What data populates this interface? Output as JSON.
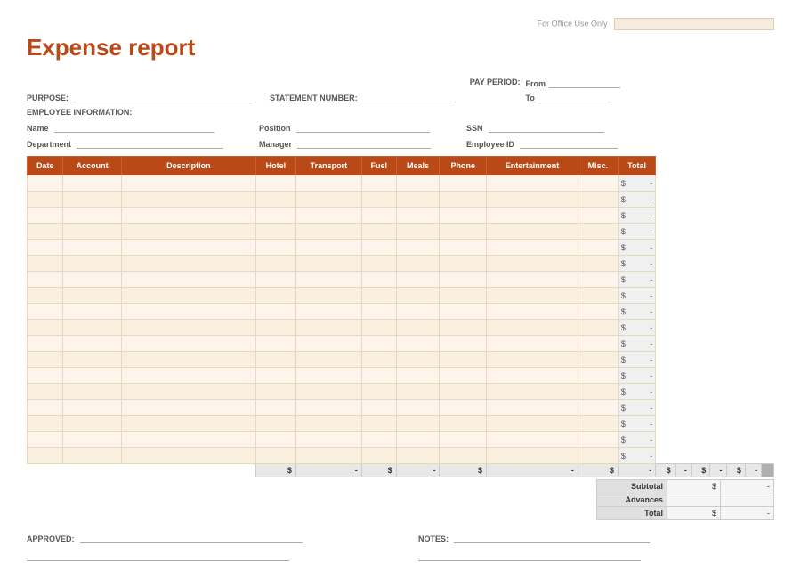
{
  "office_use": {
    "label": "For Office Use Only",
    "box_placeholder": ""
  },
  "title": "Expense report",
  "purpose": {
    "label": "PURPOSE:"
  },
  "statement": {
    "label": "STATEMENT NUMBER:"
  },
  "pay_period": {
    "label": "PAY PERIOD:",
    "from_label": "From",
    "to_label": "To"
  },
  "employee_info": {
    "section_label": "EMPLOYEE INFORMATION:",
    "name_label": "Name",
    "position_label": "Position",
    "ssn_label": "SSN",
    "department_label": "Department",
    "manager_label": "Manager",
    "employee_id_label": "Employee ID"
  },
  "table": {
    "headers": [
      "Date",
      "Account",
      "Description",
      "Hotel",
      "Transport",
      "Fuel",
      "Meals",
      "Phone",
      "Entertainment",
      "Misc.",
      "Total"
    ],
    "num_rows": 18,
    "dollar_sign": "$",
    "dash": "-"
  },
  "totals_row": {
    "cells": [
      "$",
      "-",
      "$",
      "-",
      "$",
      "-",
      "$",
      "-",
      "$",
      "-",
      "$",
      "-",
      "$",
      "-"
    ]
  },
  "summary": {
    "subtotal_label": "Subtotal",
    "advances_label": "Advances",
    "total_label": "Total",
    "dollar": "$",
    "dash": "-"
  },
  "footer": {
    "approved_label": "APPROVED:",
    "notes_label": "NOTES:"
  }
}
